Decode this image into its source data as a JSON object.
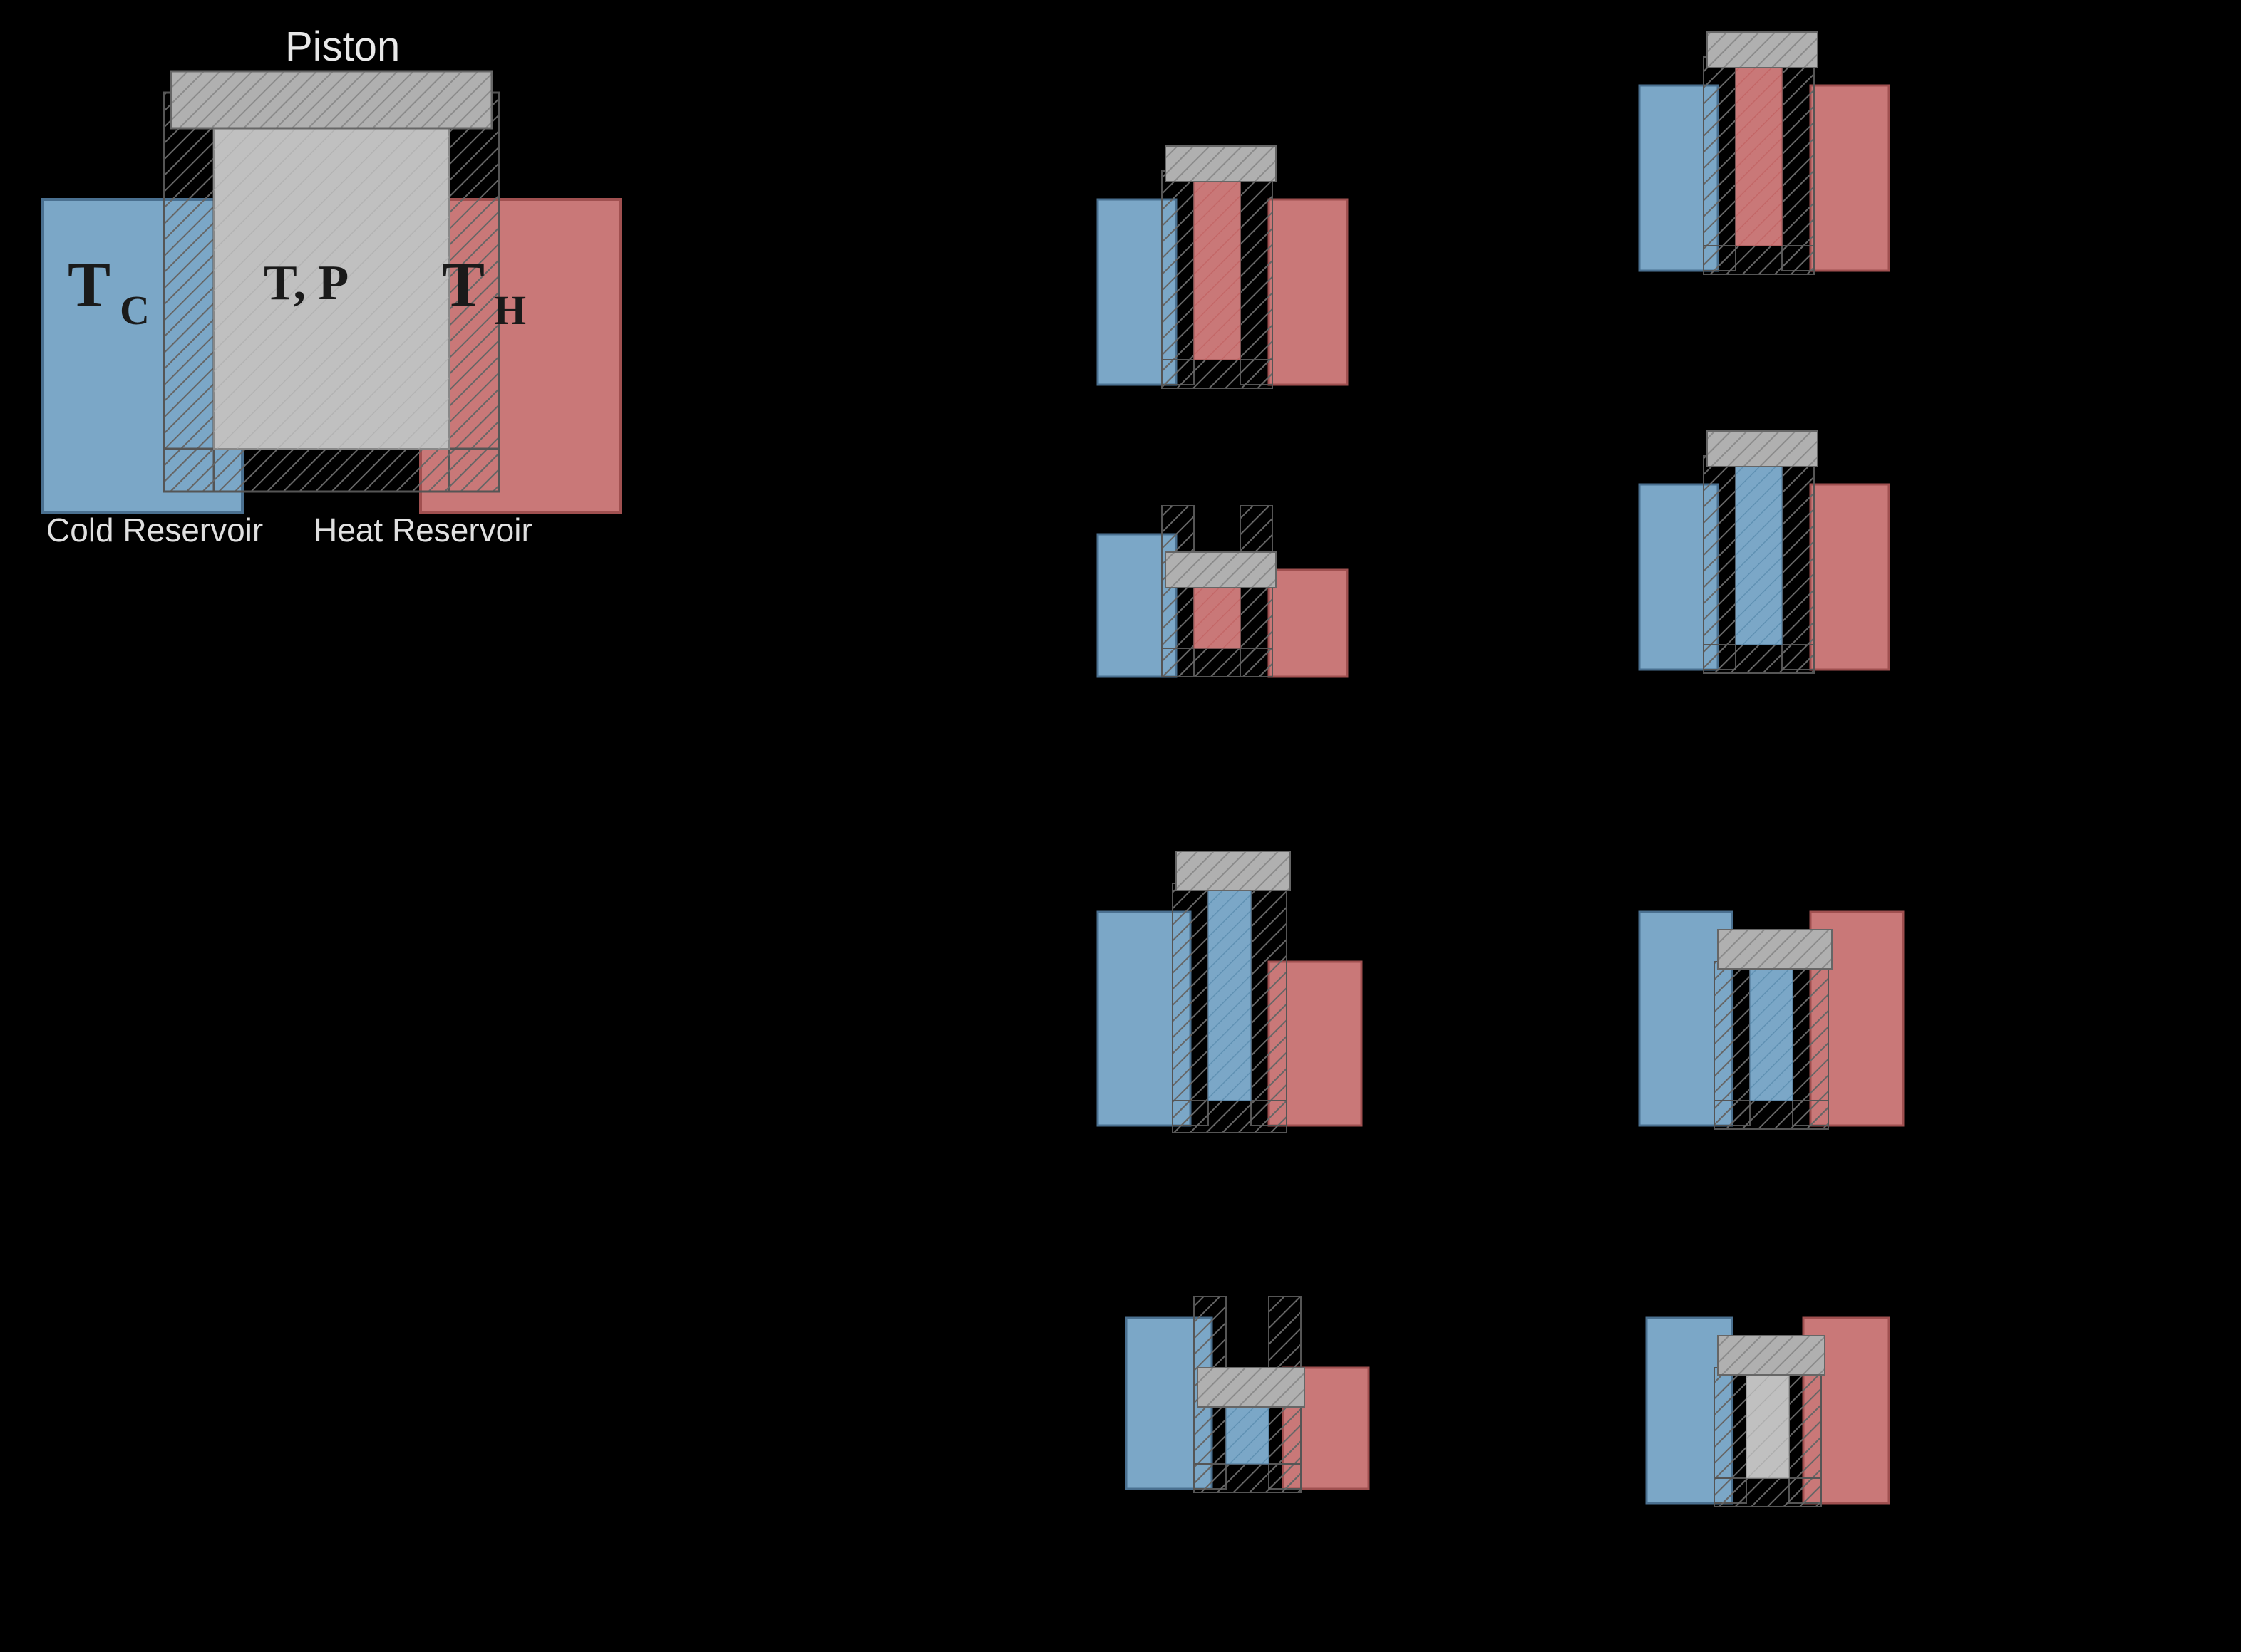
{
  "main_diagram": {
    "piston_label": "Piston",
    "tp_label": "T, P",
    "tc_label": "T",
    "tc_subscript": "C",
    "th_label": "T",
    "th_subscript": "H",
    "cold_reservoir_label": "Cold Reservoir",
    "heat_reservoir_label": "Heat Reservoir"
  },
  "colors": {
    "cold": "#7ba7c7",
    "hot": "#c97878",
    "piston": "#b8b8b8",
    "background": "#000000",
    "text_light": "#e8e8e8",
    "text_dark": "#1a1a1a",
    "hatch_stroke": "#888888",
    "border": "#333333"
  }
}
